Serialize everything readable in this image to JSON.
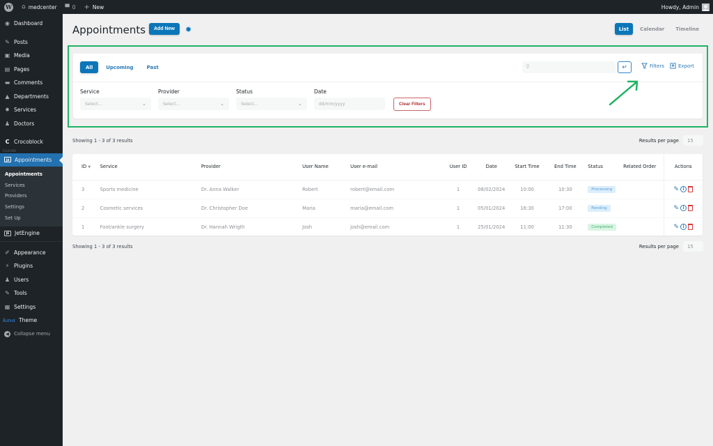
{
  "adminbar": {
    "site_name": "medcenter",
    "comments_count": "0",
    "new_label": "New",
    "howdy": "Howdy, Admin"
  },
  "sidebar": {
    "items": [
      {
        "label": "Dashboard",
        "icon": "dashboard-icon"
      },
      {
        "label": "Posts",
        "icon": "pin-icon"
      },
      {
        "label": "Media",
        "icon": "media-icon"
      },
      {
        "label": "Pages",
        "icon": "pages-icon"
      },
      {
        "label": "Comments",
        "icon": "comment-icon"
      },
      {
        "label": "Departments",
        "icon": "building-icon"
      },
      {
        "label": "Services",
        "icon": "gear-icon"
      },
      {
        "label": "Doctors",
        "icon": "user-icon"
      },
      {
        "label": "Crocoblock",
        "icon": "crocoblock-icon"
      }
    ],
    "plugin_label": "PLUGINS",
    "active_item": {
      "label": "Appointments",
      "icon": "jet-appointments-icon"
    },
    "submenu": [
      {
        "label": "Appointments",
        "current": true
      },
      {
        "label": "Services",
        "current": false
      },
      {
        "label": "Providers",
        "current": false
      },
      {
        "label": "Settings",
        "current": false
      },
      {
        "label": "Set Up",
        "current": false
      }
    ],
    "items_after": [
      {
        "label": "JetEngine",
        "icon": "jetengine-icon"
      },
      {
        "label": "Appearance",
        "icon": "brush-icon"
      },
      {
        "label": "Plugins",
        "icon": "plugin-icon"
      },
      {
        "label": "Users",
        "icon": "users-icon"
      },
      {
        "label": "Tools",
        "icon": "wrench-icon"
      },
      {
        "label": "Settings",
        "icon": "settings-icon"
      }
    ],
    "theme_logo": "kava",
    "theme_label": "Theme",
    "collapse_label": "Collapse menu"
  },
  "header": {
    "title": "Appointments",
    "add_new": "Add New",
    "views": [
      {
        "label": "List",
        "active": true
      },
      {
        "label": "Calendar",
        "active": false
      },
      {
        "label": "Timeline",
        "active": false
      }
    ]
  },
  "filters": {
    "tabs": [
      {
        "label": "All",
        "active": true
      },
      {
        "label": "Upcoming",
        "active": false
      },
      {
        "label": "Past",
        "active": false
      }
    ],
    "search_placeholder": "",
    "filters_label": "Filters",
    "export_label": "Export",
    "fields": [
      {
        "label": "Service",
        "placeholder": "Select..."
      },
      {
        "label": "Provider",
        "placeholder": "Select..."
      },
      {
        "label": "Status",
        "placeholder": "Select..."
      }
    ],
    "date_label": "Date",
    "date_placeholder": "dd/mm/yyyy",
    "clear_label": "Clear Filters",
    "highlight_color": "#1fb363"
  },
  "pagination": {
    "showing": "Showing 1 - 3 of 3 results",
    "rpp_label": "Results per page",
    "rpp_value": "15"
  },
  "table": {
    "headers": {
      "id": "ID",
      "service": "Service",
      "provider": "Provider",
      "user_name": "User Name",
      "user_email": "User e-mail",
      "user_id": "User ID",
      "date": "Date",
      "start": "Start Time",
      "end": "End Time",
      "status": "Status",
      "order": "Related Order",
      "actions": "Actions"
    },
    "rows": [
      {
        "id": "3",
        "service": "Sports medicine",
        "provider": "Dr. Anna Walker",
        "user_name": "Robert",
        "user_email": "robert@email.com",
        "user_id": "1",
        "date": "08/02/2024",
        "start": "10:00",
        "end": "10:30",
        "status": "Processing",
        "order": ""
      },
      {
        "id": "2",
        "service": "Cosmetic services",
        "provider": "Dr. Christopher Doe",
        "user_name": "Maria",
        "user_email": "maria@email.com",
        "user_id": "1",
        "date": "05/01/2024",
        "start": "16:30",
        "end": "17:00",
        "status": "Pending",
        "order": ""
      },
      {
        "id": "1",
        "service": "Foot/ankle surgery",
        "provider": "Dr. Hannah Wrigth",
        "user_name": "Josh",
        "user_email": "josh@email.com",
        "user_id": "1",
        "date": "25/01/2024",
        "start": "11:00",
        "end": "11:30",
        "status": "Completed",
        "order": ""
      }
    ],
    "status_colors": {
      "Processing": {
        "bg": "#dbeefb",
        "fg": "#5a9bd0"
      },
      "Pending": {
        "bg": "#dbeefb",
        "fg": "#5a9bd0"
      },
      "Completed": {
        "bg": "#d9f5e3",
        "fg": "#45b06f"
      }
    }
  }
}
